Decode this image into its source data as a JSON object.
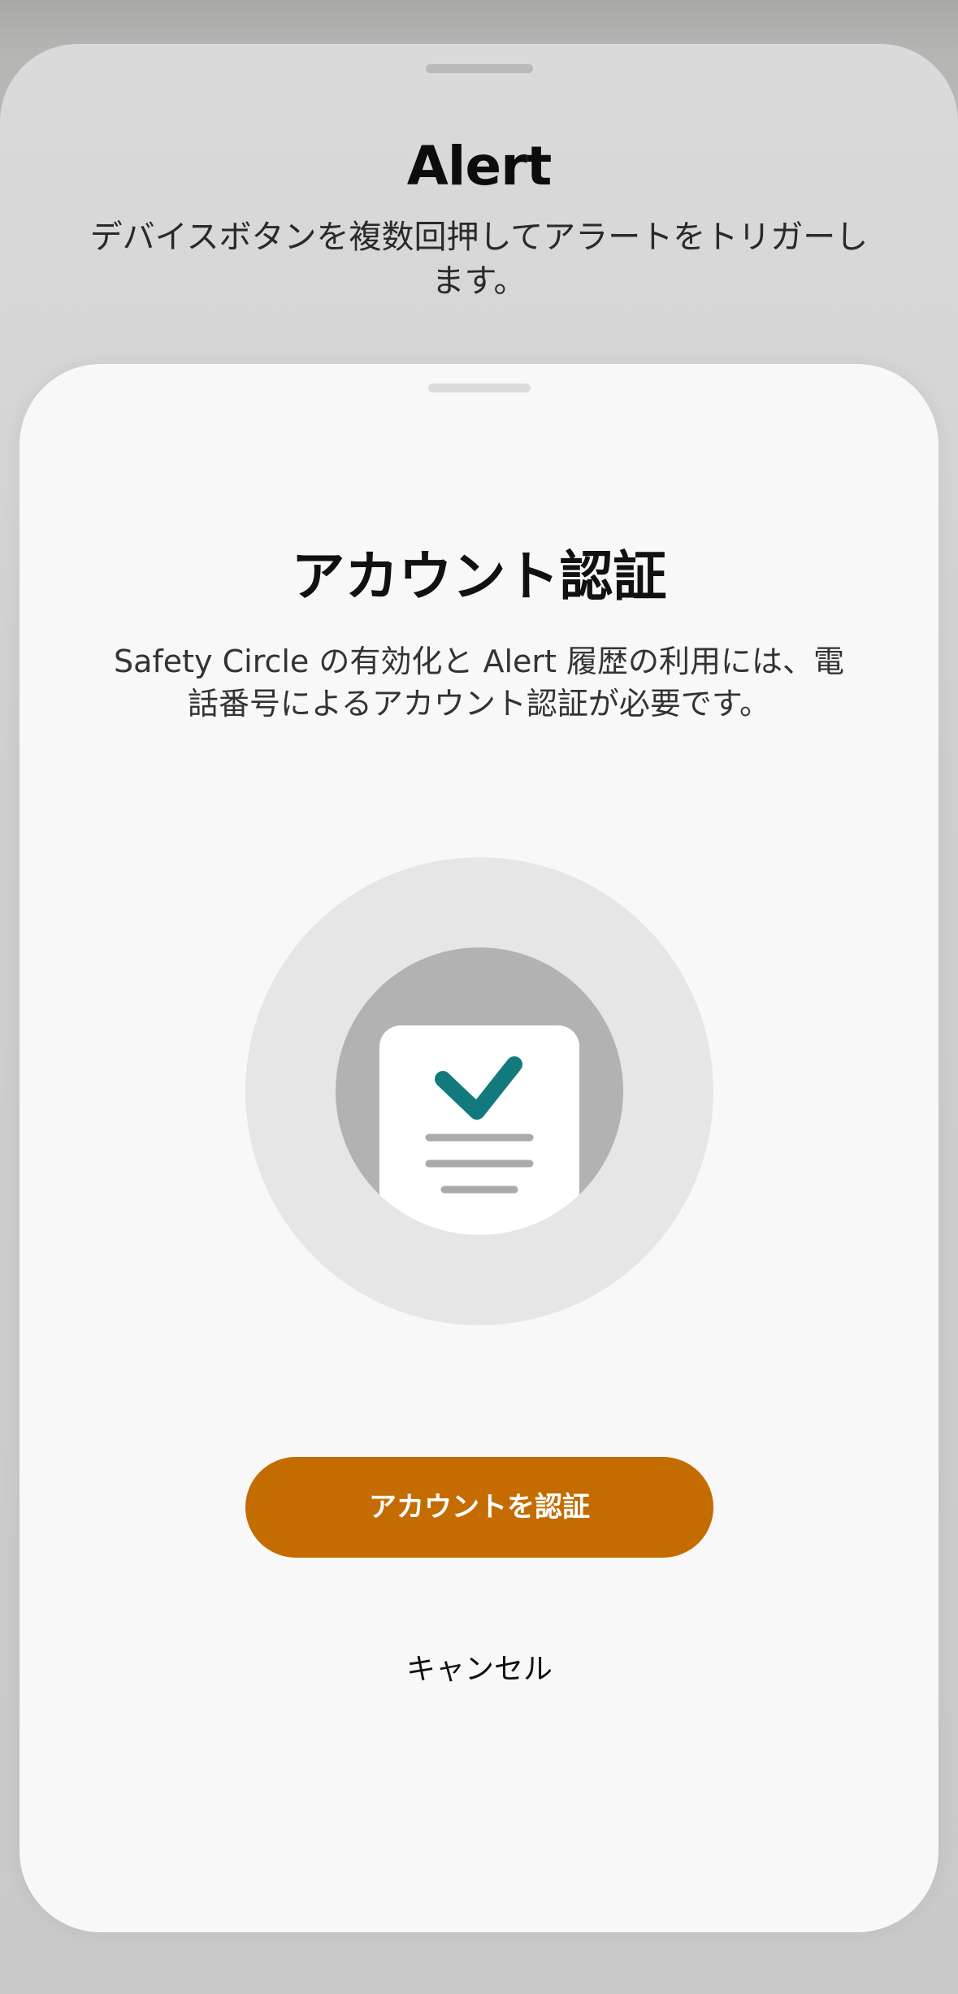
{
  "background_sheet": {
    "title": "Alert",
    "subtitle": "デバイスボタンを複数回押してアラートをトリガーします。"
  },
  "verify_sheet": {
    "title": "アカウント認証",
    "description": "Safety Circle の有効化と Alert 履歴の利用には、電話番号によるアカウント認証が必要です。",
    "illustration_icon": "document-checkmark-icon",
    "primary_button_label": "アカウントを認証",
    "cancel_label": "キャンセル"
  },
  "colors": {
    "accent": "#c46c00",
    "check": "#127a7d",
    "sheet": "#f8f8f8"
  }
}
